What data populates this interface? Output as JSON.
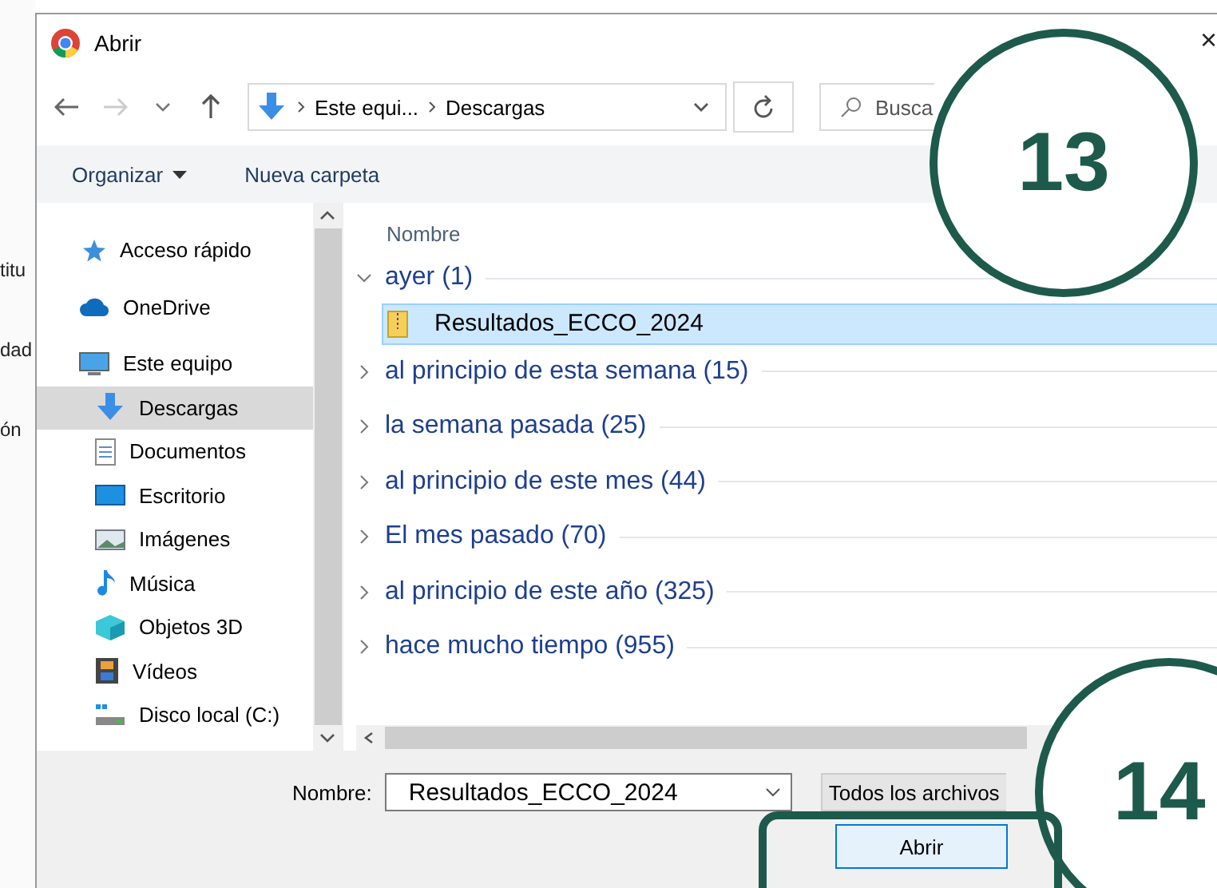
{
  "background_page": {
    "fragments": [
      "titu",
      "dad",
      "ón"
    ]
  },
  "window": {
    "title": "Abrir",
    "close": "×"
  },
  "navigation": {
    "path": [
      "Este equi...",
      "Descargas"
    ],
    "search_placeholder": "Busca"
  },
  "toolbar": {
    "items": [
      {
        "label": "Organizar",
        "kind": "menu"
      },
      {
        "label": "Nueva carpeta",
        "kind": "button"
      }
    ]
  },
  "sidebar": {
    "items": [
      {
        "label": "Acceso rápido",
        "kind": "star",
        "selected": false
      },
      {
        "label": "OneDrive",
        "kind": "cloud",
        "selected": false
      },
      {
        "label": "Este equipo",
        "kind": "monitor",
        "selected": false,
        "children": [
          {
            "label": "Descargas",
            "kind": "download",
            "selected": true
          },
          {
            "label": "Documentos",
            "kind": "document",
            "selected": false
          },
          {
            "label": "Escritorio",
            "kind": "desktop",
            "selected": false
          },
          {
            "label": "Imágenes",
            "kind": "image",
            "selected": false
          },
          {
            "label": "Música",
            "kind": "music",
            "selected": false
          },
          {
            "label": "Objetos 3D",
            "kind": "cube",
            "selected": false
          },
          {
            "label": "Vídeos",
            "kind": "film",
            "selected": false
          },
          {
            "label": "Disco local (C:)",
            "kind": "drive",
            "selected": false
          }
        ]
      }
    ]
  },
  "content": {
    "column": "Nombre",
    "groups": [
      {
        "label": "ayer (1)",
        "expanded": true,
        "files": [
          {
            "name": "Resultados_ECCO_2024",
            "selected": true
          }
        ]
      },
      {
        "label": "al principio de esta semana (15)",
        "expanded": false
      },
      {
        "label": "la semana pasada (25)",
        "expanded": false
      },
      {
        "label": "al principio de este mes (44)",
        "expanded": false
      },
      {
        "label": "El mes pasado (70)",
        "expanded": false
      },
      {
        "label": "al principio de este año (325)",
        "expanded": false
      },
      {
        "label": "hace mucho tiempo (955)",
        "expanded": false
      }
    ]
  },
  "footer": {
    "filename_label": "Nombre:",
    "filename": "Resultados_ECCO_2024",
    "filetype": "Todos los archivos",
    "buttons": [
      "Abrir"
    ]
  },
  "annotations": [
    {
      "label": "13",
      "kind": "circle"
    },
    {
      "label": "14",
      "kind": "circle"
    },
    {
      "kind": "frame"
    }
  ]
}
